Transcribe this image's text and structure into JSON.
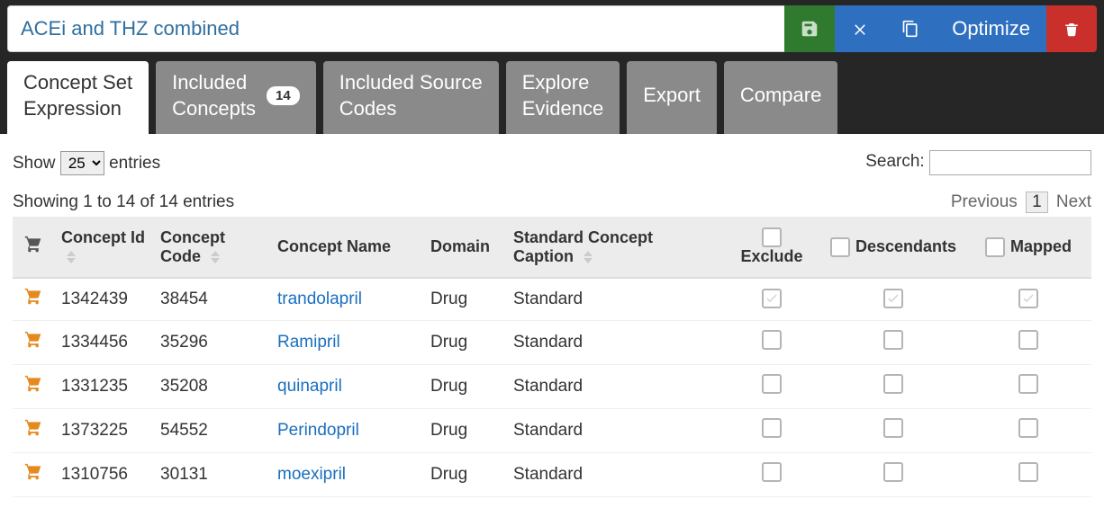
{
  "title": "ACEi and THZ combined",
  "toolbar": {
    "save": "Save",
    "close": "Close",
    "copy": "Copy",
    "optimize": "Optimize",
    "trash": "Delete"
  },
  "tabs": [
    {
      "label_l1": "Concept Set",
      "label_l2": "Expression",
      "active": true
    },
    {
      "label_l1": "Included",
      "label_l2": "Concepts",
      "badge": "14"
    },
    {
      "label_l1": "Included Source",
      "label_l2": "Codes"
    },
    {
      "label_l1": "Explore",
      "label_l2": "Evidence"
    },
    {
      "label_l1": "Export"
    },
    {
      "label_l1": "Compare"
    }
  ],
  "controls": {
    "show_pre": "Show",
    "show_val": "25",
    "show_suf": "entries",
    "search_label": "Search:",
    "info": "Showing 1 to 14 of 14 entries",
    "prev": "Previous",
    "page": "1",
    "next": "Next"
  },
  "columns": {
    "cart": "",
    "id": "Concept Id",
    "code": "Concept Code",
    "name": "Concept Name",
    "domain": "Domain",
    "std": "Standard Concept Caption",
    "exclude": "Exclude",
    "desc": "Descendants",
    "mapped": "Mapped"
  },
  "rows": [
    {
      "id": "1342439",
      "code": "38454",
      "name": "trandolapril",
      "domain": "Drug",
      "std": "Standard",
      "excl_disabled": true,
      "desc_disabled": true,
      "map_disabled": true
    },
    {
      "id": "1334456",
      "code": "35296",
      "name": "Ramipril",
      "domain": "Drug",
      "std": "Standard",
      "excl_disabled": false,
      "desc_disabled": false,
      "map_disabled": false
    },
    {
      "id": "1331235",
      "code": "35208",
      "name": "quinapril",
      "domain": "Drug",
      "std": "Standard",
      "excl_disabled": false,
      "desc_disabled": false,
      "map_disabled": false
    },
    {
      "id": "1373225",
      "code": "54552",
      "name": "Perindopril",
      "domain": "Drug",
      "std": "Standard",
      "excl_disabled": false,
      "desc_disabled": false,
      "map_disabled": false
    },
    {
      "id": "1310756",
      "code": "30131",
      "name": "moexipril",
      "domain": "Drug",
      "std": "Standard",
      "excl_disabled": false,
      "desc_disabled": false,
      "map_disabled": false
    }
  ]
}
